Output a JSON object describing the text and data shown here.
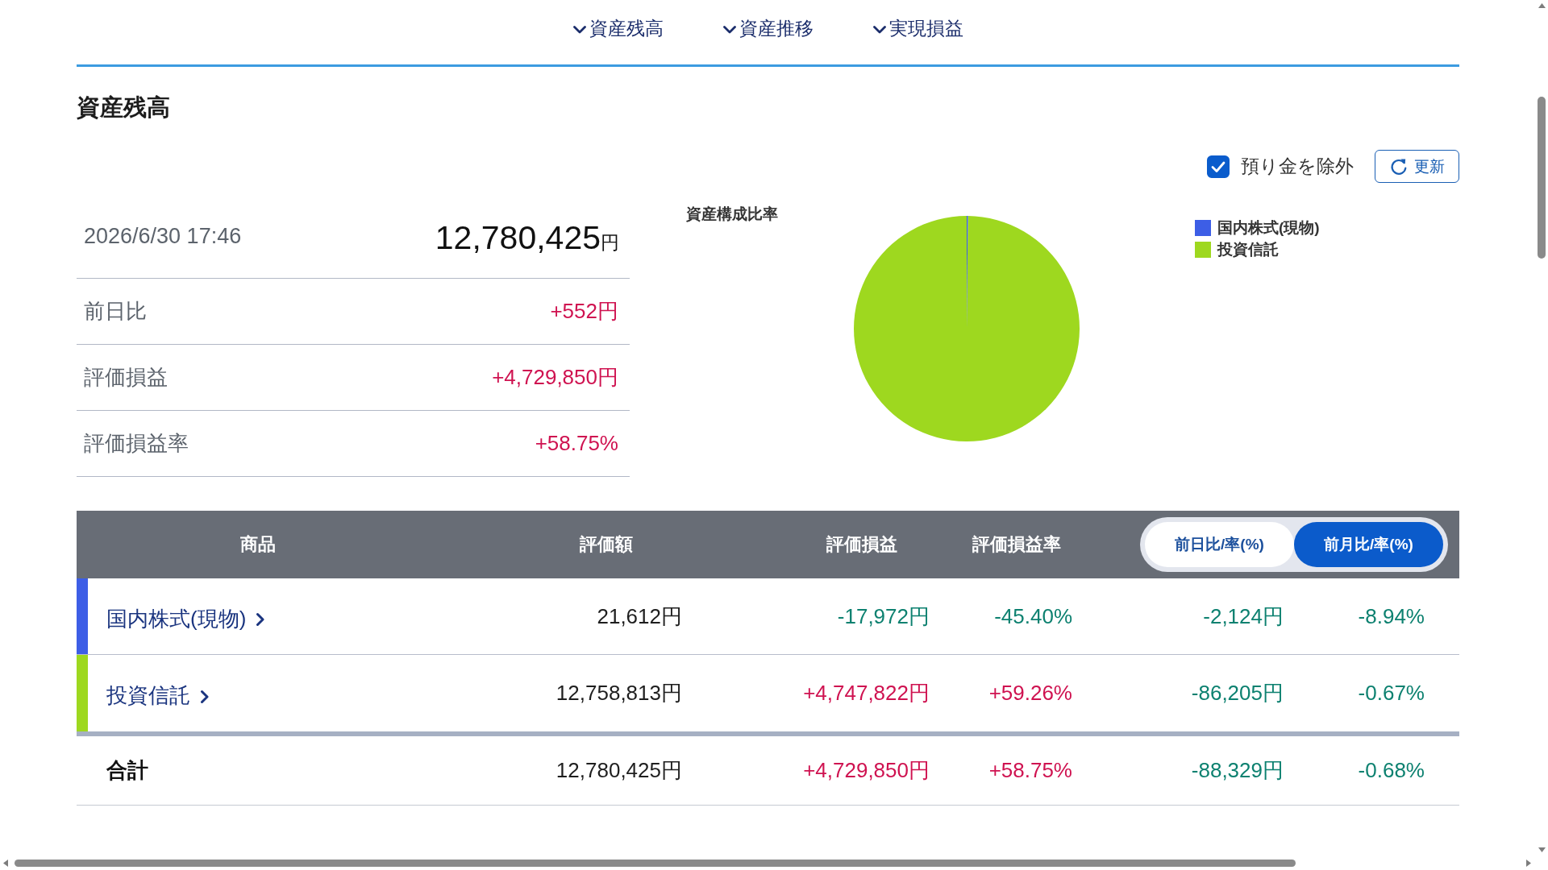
{
  "nav": {
    "items": [
      {
        "label": "資産残高"
      },
      {
        "label": "資産推移"
      },
      {
        "label": "実現損益"
      }
    ]
  },
  "section": {
    "title": "資産残高"
  },
  "controls": {
    "checkbox": {
      "label": "預り金を除外",
      "checked": true
    },
    "refresh_button": {
      "label": "更新"
    }
  },
  "summary": {
    "timestamp": "2026/6/30 17:46",
    "total": {
      "value": "12,780,425",
      "unit": "円"
    },
    "rows": [
      {
        "label": "前日比",
        "value": "+552円",
        "color": "#cf1250"
      },
      {
        "label": "評価損益",
        "value": "+4,729,850円",
        "color": "#cf1250"
      },
      {
        "label": "評価損益率",
        "value": "+58.75%",
        "color": "#cf1250"
      }
    ]
  },
  "chart": {
    "chart_data": {
      "type": "pie",
      "title": "資産構成比率",
      "categories": [
        "国内株式(現物)",
        "投資信託"
      ],
      "values": [
        0.17,
        99.83
      ],
      "colors": [
        "#3d5ee6",
        "#9ed81f"
      ]
    }
  },
  "table": {
    "columns": [
      "商品",
      "評価額",
      "評価損益",
      "評価損益率"
    ],
    "period_toggle": [
      {
        "label": "前日比/率(%)",
        "selected": false
      },
      {
        "label": "前月比/率(%)",
        "selected": true
      }
    ],
    "rows": [
      {
        "kind": "item",
        "color": "#3d5ee6",
        "cells": [
          {
            "text": "国内株式(現物)"
          },
          {
            "text": "21,612円"
          },
          {
            "text": "-17,972円",
            "color": "#0d8170"
          },
          {
            "text": "-45.40%",
            "color": "#0d8170"
          },
          {
            "text": "-2,124円",
            "color": "#0d8170"
          },
          {
            "text": "-8.94%",
            "color": "#0d8170"
          }
        ]
      },
      {
        "kind": "item",
        "color": "#9ed81f",
        "cells": [
          {
            "text": "投資信託"
          },
          {
            "text": "12,758,813円"
          },
          {
            "text": "+4,747,822円",
            "color": "#cf1250"
          },
          {
            "text": "+59.26%",
            "color": "#cf1250"
          },
          {
            "text": "-86,205円",
            "color": "#0d8170"
          },
          {
            "text": "-0.67%",
            "color": "#0d8170"
          }
        ]
      },
      {
        "kind": "total",
        "cells": [
          {
            "text": "合計"
          },
          {
            "text": "12,780,425円"
          },
          {
            "text": "+4,729,850円",
            "color": "#cf1250"
          },
          {
            "text": "+58.75%",
            "color": "#cf1250"
          },
          {
            "text": "-88,329円",
            "color": "#0d8170"
          },
          {
            "text": "-0.68%",
            "color": "#0d8170"
          }
        ]
      }
    ]
  }
}
